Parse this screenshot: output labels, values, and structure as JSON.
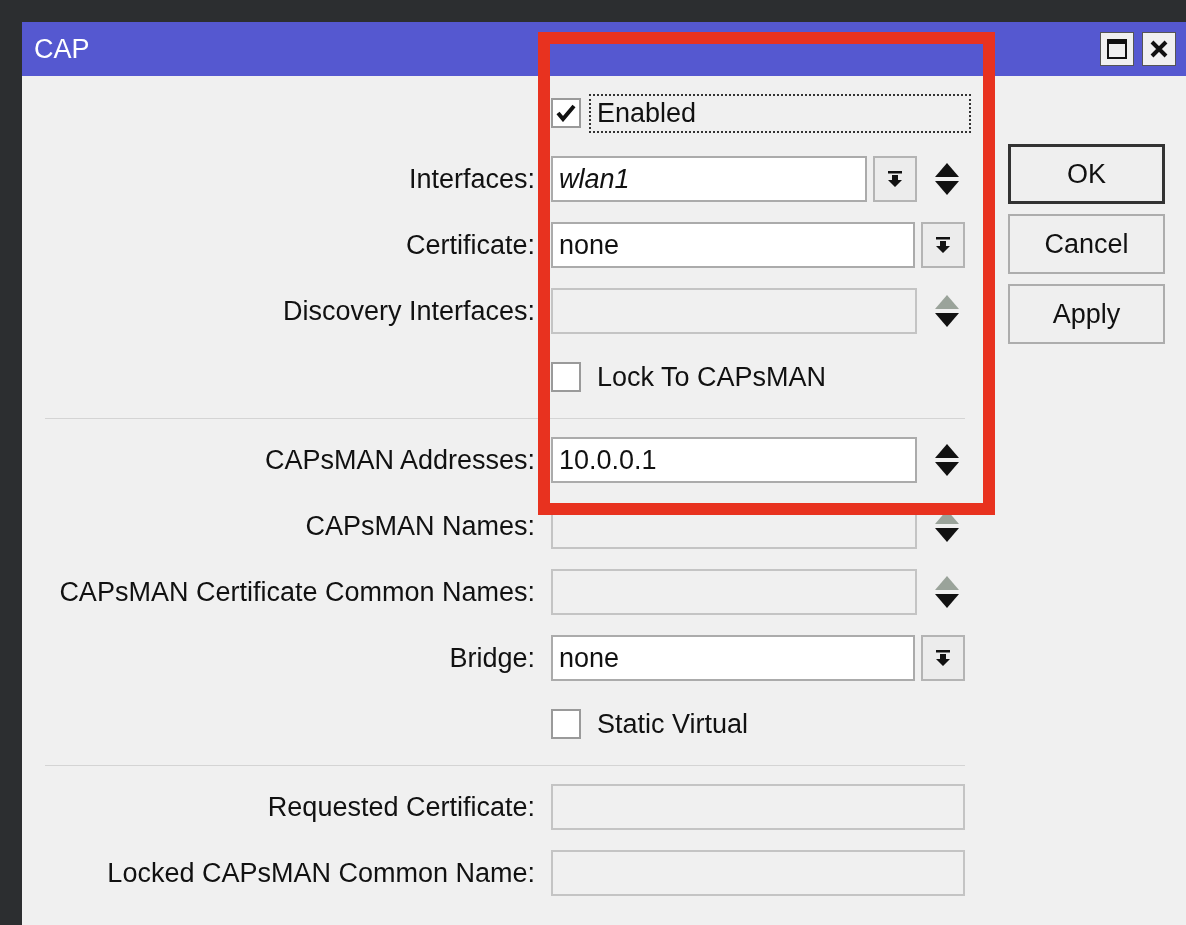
{
  "window": {
    "title": "CAP"
  },
  "sections": [
    {
      "rows": [
        {
          "kind": "checkbox",
          "label": "Enabled",
          "checked": true,
          "focused": true
        },
        {
          "kind": "combo",
          "label": "Interfaces:",
          "value": "wlan1",
          "italic": true,
          "up_disabled": false
        },
        {
          "kind": "dropdown",
          "label": "Certificate:",
          "value": "none"
        },
        {
          "kind": "spin",
          "label": "Discovery Interfaces:",
          "disabled": true,
          "up_disabled": true
        },
        {
          "kind": "checkbox",
          "label": "Lock To CAPsMAN",
          "checked": false,
          "focused": false
        }
      ]
    },
    {
      "rows": [
        {
          "kind": "spin",
          "label": "CAPsMAN Addresses:",
          "value": "10.0.0.1",
          "disabled": false,
          "up_disabled": false
        },
        {
          "kind": "spin",
          "label": "CAPsMAN Names:",
          "disabled": true,
          "up_disabled": true
        },
        {
          "kind": "spin",
          "label": "CAPsMAN Certificate Common Names:",
          "disabled": true,
          "up_disabled": true
        },
        {
          "kind": "dropdown",
          "label": "Bridge:",
          "value": "none"
        },
        {
          "kind": "checkbox",
          "label": "Static Virtual",
          "checked": false,
          "focused": false
        }
      ]
    },
    {
      "rows": [
        {
          "kind": "plain",
          "label": "Requested Certificate:",
          "disabled": true
        },
        {
          "kind": "plain",
          "label": "Locked CAPsMAN Common Name:",
          "disabled": true
        }
      ]
    }
  ],
  "buttons": [
    {
      "label": "OK",
      "default": true
    },
    {
      "label": "Cancel",
      "default": false
    },
    {
      "label": "Apply",
      "default": false
    }
  ]
}
